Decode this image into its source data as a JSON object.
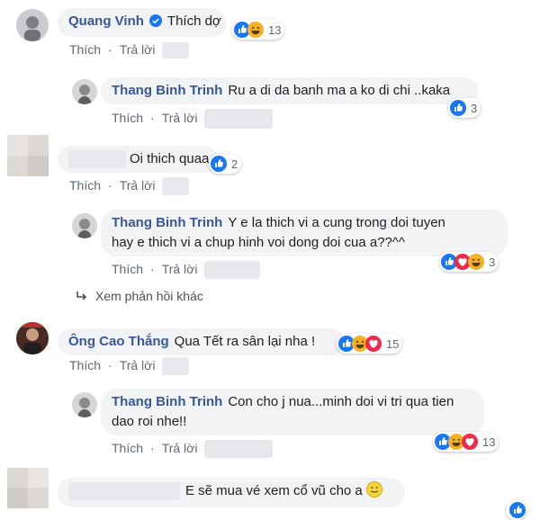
{
  "actions": {
    "like": "Thích",
    "reply": "Trả lời",
    "sep": "·"
  },
  "comments": [
    {
      "name": "Quang Vinh",
      "text": "Thích dợ",
      "reactions_count": "13"
    },
    {
      "name": "Thang Binh Trinh",
      "text": "Ru a di da banh ma a ko di chi ..kaka",
      "reactions_count": "3"
    },
    {
      "name": "",
      "text": "Oi thich quaa",
      "reactions_count": "2"
    },
    {
      "name": "Thang Binh Trinh",
      "text_line1": "Y e la thich vi a cung trong doi tuyen",
      "text_line2": "hay e thich vi a chup hinh voi dong doi cua a??^^",
      "reactions_count": "3"
    },
    {
      "name": "Ông Cao Thắng",
      "text": "Qua Tết ra sân lại nha !",
      "reactions_count": "15"
    },
    {
      "name": "Thang Binh Trinh",
      "text_line1": "Con cho j nua...minh doi vi tri qua tien",
      "text_line2": "dao roi nhe!!",
      "reactions_count": "13"
    },
    {
      "name": "",
      "text": "E sẽ mua vé xem cổ vũ cho a"
    }
  ],
  "more_replies": "Xem phản hồi khác",
  "colors": {
    "link": "#385898",
    "bubble": "#f2f3f5",
    "meta": "#616770",
    "like_blue": "#1877f2"
  },
  "icons": [
    "verified-badge-icon",
    "like-reaction-icon",
    "haha-reaction-icon",
    "love-reaction-icon",
    "reply-arrow-icon",
    "smile-emoji-icon"
  ]
}
